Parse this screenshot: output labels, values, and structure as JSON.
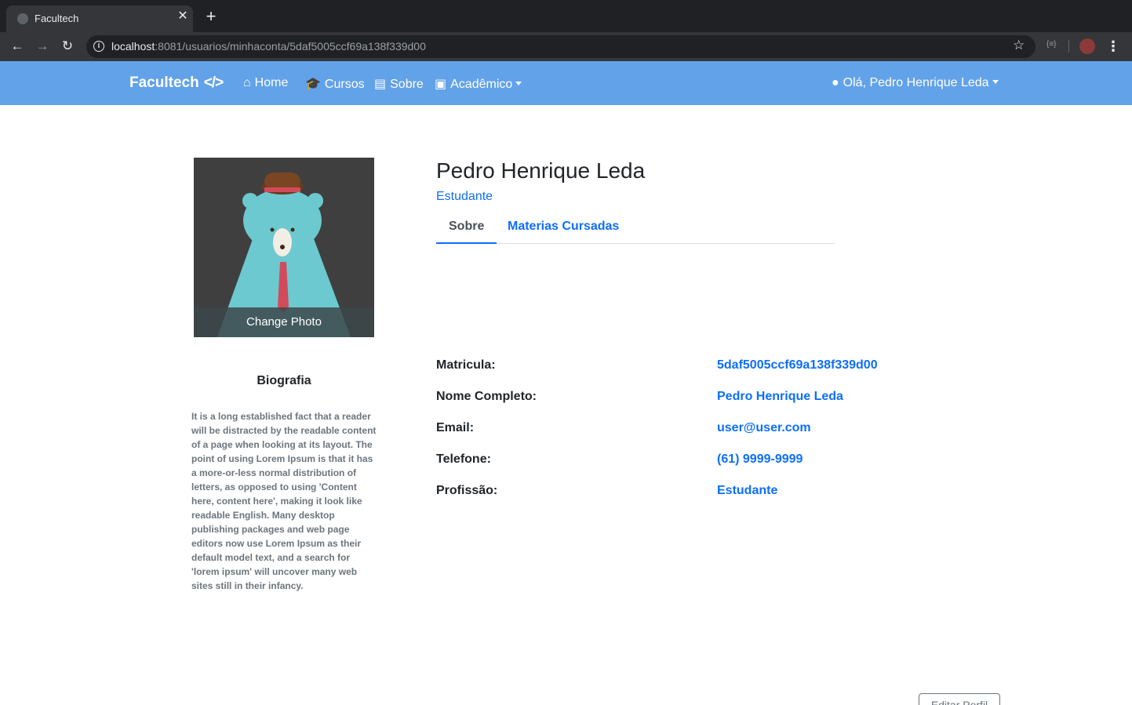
{
  "browser": {
    "tab_title": "Facultech",
    "url_host": "localhost",
    "url_rest": ":8081/usuarios/minhaconta/5daf5005ccf69a138f339d00"
  },
  "navbar": {
    "brand": "Facultech",
    "links": [
      {
        "label": "Home",
        "icon": "home-icon"
      },
      {
        "label": "Cursos",
        "icon": "graduation-cap-icon"
      },
      {
        "label": "Sobre",
        "icon": "list-icon"
      },
      {
        "label": "Acadêmico",
        "icon": "book-reader-icon"
      }
    ],
    "user_menu": "Olá, Pedro Henrique Leda"
  },
  "profile": {
    "photo_action": "Change Photo",
    "bio_title": "Biografia",
    "bio_text": "It is a long established fact that a reader will be distracted by the readable content of a page when looking at its layout. The point of using Lorem Ipsum is that it has a more-or-less normal distribution of letters, as opposed to using 'Content here, content here', making it look like readable English. Many desktop publishing packages and web page editors now use Lorem Ipsum as their default model text, and a search for 'lorem ipsum' will uncover many web sites still in their infancy.",
    "name": "Pedro Henrique Leda",
    "role": "Estudante",
    "tabs": [
      "Sobre",
      "Materias Cursadas"
    ],
    "fields": [
      {
        "label": "Matricula:",
        "value": "5daf5005ccf69a138f339d00"
      },
      {
        "label": "Nome Completo:",
        "value": "Pedro Henrique Leda"
      },
      {
        "label": "Email:",
        "value": "user@user.com"
      },
      {
        "label": "Telefone:",
        "value": "(61) 9999-9999"
      },
      {
        "label": "Profissão:",
        "value": "Estudante"
      }
    ],
    "edit_button": "Editar Perfil"
  },
  "colors": {
    "navbar": "#62a2e9",
    "link": "#0d6efd"
  }
}
